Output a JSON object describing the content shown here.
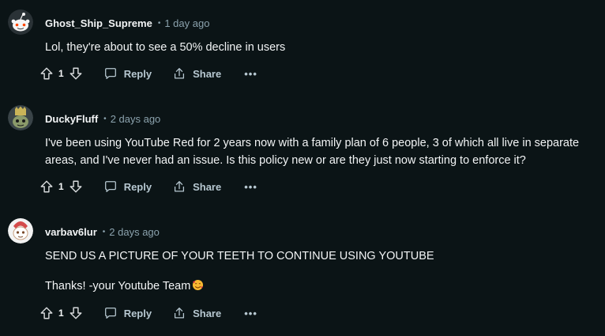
{
  "comments": [
    {
      "author": "Ghost_Ship_Supreme",
      "separator": "•",
      "time": "1 day ago",
      "lines": [
        "Lol, they're about to see a 50% decline in users"
      ],
      "score": "1",
      "reply": "Reply",
      "share": "Share",
      "more": "•••"
    },
    {
      "author": "DuckyFluff",
      "separator": "•",
      "time": "2 days ago",
      "lines": [
        "I've been using YouTube Red for 2 years now with a family plan of 6 people, 3 of which all live in separate areas, and I've never had an issue. Is this policy new or are they just now starting to enforce it?"
      ],
      "score": "1",
      "reply": "Reply",
      "share": "Share",
      "more": "•••"
    },
    {
      "author": "varbav6lur",
      "separator": "•",
      "time": "2 days ago",
      "lines": [
        "SEND US A PICTURE OF YOUR TEETH TO CONTINUE USING YOUTUBE",
        "Thanks! -your Youtube Team"
      ],
      "score": "1",
      "reply": "Reply",
      "share": "Share",
      "more": "•••"
    }
  ]
}
